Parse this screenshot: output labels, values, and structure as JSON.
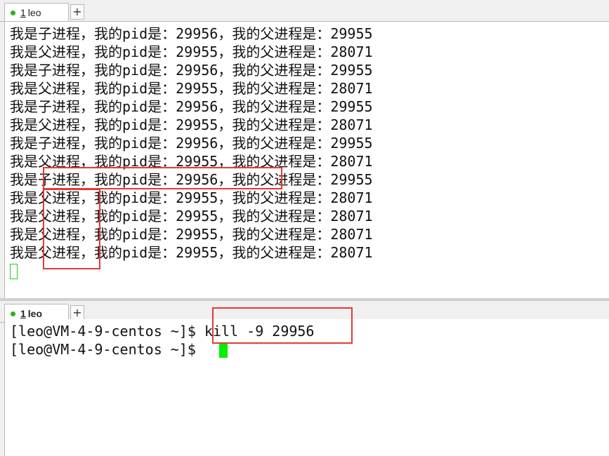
{
  "top_pane": {
    "tab": {
      "number": "1",
      "name": "leo"
    },
    "add_tab": "+",
    "lines": [
      "我是子进程，我的pid是：29956，我的父进程是：29955",
      "我是父进程，我的pid是：29955，我的父进程是：28071",
      "我是子进程，我的pid是：29956，我的父进程是：29955",
      "我是父进程，我的pid是：29955，我的父进程是：28071",
      "我是子进程，我的pid是：29956，我的父进程是：29955",
      "我是父进程，我的pid是：29955，我的父进程是：28071",
      "我是子进程，我的pid是：29956，我的父进程是：29955",
      "我是父进程，我的pid是：29955，我的父进程是：28071",
      "我是子进程，我的pid是：29956，我的父进程是：29955",
      "我是父进程，我的pid是：29955，我的父进程是：28071",
      "我是父进程，我的pid是：29955，我的父进程是：28071",
      "我是父进程，我的pid是：29955，我的父进程是：28071",
      "我是父进程，我的pid是：29955，我的父进程是：28071"
    ]
  },
  "bottom_pane": {
    "tab": {
      "number": "1",
      "name": "leo"
    },
    "add_tab": "+",
    "lines": [
      "[leo@VM-4-9-centos ~]$ kill -9 29956",
      "[leo@VM-4-9-centos ~]$ "
    ]
  },
  "colors": {
    "highlight": "#e53935",
    "cursor": "#00ee00",
    "tab_dot": "#27b327"
  }
}
